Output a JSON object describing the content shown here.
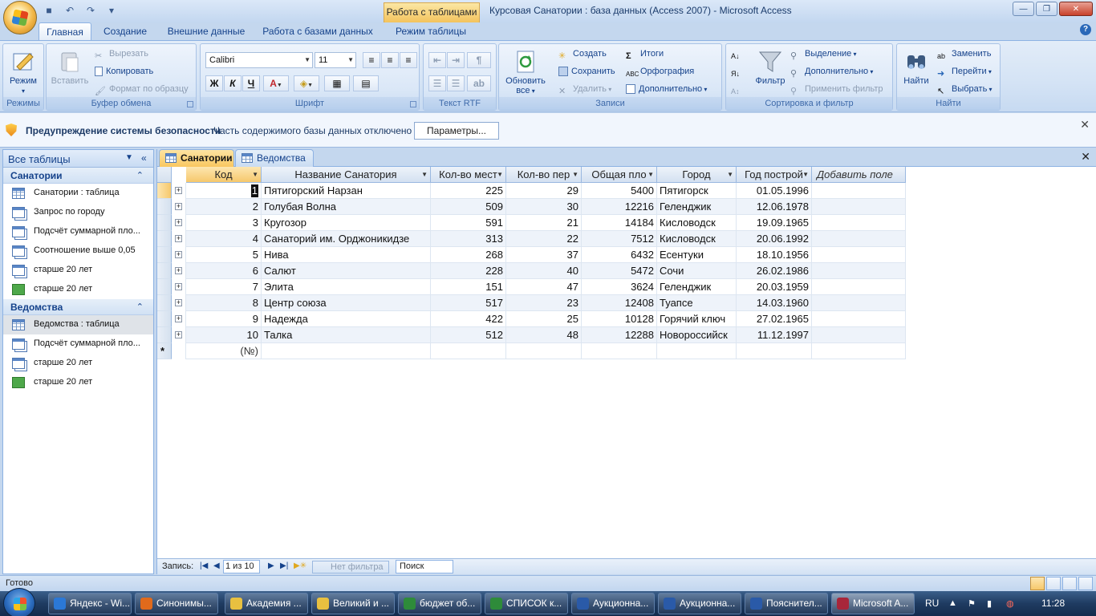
{
  "app": {
    "context_tab": "Работа с таблицами",
    "window_title": "Курсовая Санатории : база данных (Access 2007) - Microsoft Access"
  },
  "ribbon_tabs": [
    "Главная",
    "Создание",
    "Внешние данные",
    "Работа с базами данных",
    "Режим таблицы"
  ],
  "ribbon": {
    "modes": {
      "view_label": "Режим",
      "group_label": "Режимы"
    },
    "clipboard": {
      "paste": "Вставить",
      "cut": "Вырезать",
      "copy": "Копировать",
      "format_painter": "Формат по образцу",
      "group_label": "Буфер обмена"
    },
    "font": {
      "font_name": "Calibri",
      "font_size": "11",
      "bold": "Ж",
      "italic": "К",
      "underline": "Ч",
      "font_color_letter": "A",
      "group_label": "Шрифт"
    },
    "rtf": {
      "group_label": "Текст RTF"
    },
    "records": {
      "refresh": "Обновить",
      "refresh_all": "все",
      "create": "Создать",
      "save": "Сохранить",
      "delete": "Удалить",
      "totals": "Итоги",
      "spelling": "Орфография",
      "more": "Дополнительно",
      "group_label": "Записи"
    },
    "sort_filter": {
      "filter": "Фильтр",
      "selection": "Выделение",
      "advanced": "Дополнительно",
      "toggle_filter": "Применить фильтр",
      "group_label": "Сортировка и фильтр"
    },
    "find": {
      "find": "Найти",
      "replace": "Заменить",
      "goto": "Перейти",
      "select": "Выбрать",
      "group_label": "Найти"
    }
  },
  "security": {
    "title": "Предупреждение системы безопасности",
    "message": "Часть содержимого базы данных отключено",
    "button": "Параметры..."
  },
  "nav": {
    "header": "Все таблицы",
    "groups": [
      {
        "title": "Санатории",
        "items": [
          {
            "label": "Санатории : таблица",
            "icon": "table-icon"
          },
          {
            "label": "Запрос по городу",
            "icon": "query-icon"
          },
          {
            "label": "Подсчёт суммарной пло...",
            "icon": "query-icon"
          },
          {
            "label": "Соотношение выше 0,05",
            "icon": "query-icon"
          },
          {
            "label": "старше 20 лет",
            "icon": "query-icon"
          },
          {
            "label": "старше 20 лет",
            "icon": "form-icon"
          }
        ]
      },
      {
        "title": "Ведомства",
        "items": [
          {
            "label": "Ведомства : таблица",
            "icon": "table-icon"
          },
          {
            "label": "Подсчёт суммарной пло...",
            "icon": "query-icon"
          },
          {
            "label": "старше 20 лет",
            "icon": "query-icon"
          },
          {
            "label": "старше 20 лет",
            "icon": "form-icon"
          }
        ]
      }
    ]
  },
  "doc_tabs": [
    "Санатории",
    "Ведомства"
  ],
  "table": {
    "columns": [
      "Код",
      "Название Санатория",
      "Кол-во мест",
      "Кол-во пер",
      "Общая пло",
      "Город",
      "Год построй",
      "Добавить поле"
    ],
    "rows": [
      [
        "1",
        "Пятигорский Нарзан",
        "225",
        "29",
        "5400",
        "Пятигорск",
        "01.05.1996"
      ],
      [
        "2",
        "Голубая Волна",
        "509",
        "30",
        "12216",
        "Геленджик",
        "12.06.1978"
      ],
      [
        "3",
        "Кругозор",
        "591",
        "21",
        "14184",
        "Кисловодск",
        "19.09.1965"
      ],
      [
        "4",
        "Санаторий им. Орджоникидзе",
        "313",
        "22",
        "7512",
        "Кисловодск",
        "20.06.1992"
      ],
      [
        "5",
        "Нива",
        "268",
        "37",
        "6432",
        "Есентуки",
        "18.10.1956"
      ],
      [
        "6",
        "Салют",
        "228",
        "40",
        "5472",
        "Сочи",
        "26.02.1986"
      ],
      [
        "7",
        "Элита",
        "151",
        "47",
        "3624",
        "Геленджик",
        "20.03.1959"
      ],
      [
        "8",
        "Центр союза",
        "517",
        "23",
        "12408",
        "Туапсе",
        "14.03.1960"
      ],
      [
        "9",
        "Надежда",
        "422",
        "25",
        "10128",
        "Горячий ключ",
        "27.02.1965"
      ],
      [
        "10",
        "Талка",
        "512",
        "48",
        "12288",
        "Новороссийск",
        "11.12.1997"
      ]
    ],
    "new_row_placeholder": "(№)",
    "new_row_marker": "*"
  },
  "record_nav": {
    "label": "Запись:",
    "position": "1 из 10",
    "filter": "Нет фильтра",
    "search": "Поиск"
  },
  "status": "Готово",
  "taskbar": {
    "items": [
      {
        "label": "Яндекс - Wi...",
        "color": "#2b78d6"
      },
      {
        "label": "Синонимы...",
        "color": "#e06a1c"
      },
      {
        "label": "Академия ...",
        "color": "#e8c040"
      },
      {
        "label": "Великий и ...",
        "color": "#e8c040"
      },
      {
        "label": "бюджет об...",
        "color": "#2e8b3a"
      },
      {
        "label": "СПИСОК к...",
        "color": "#2e8b3a"
      },
      {
        "label": "Аукционна...",
        "color": "#2a5aa8"
      },
      {
        "label": "Аукционна...",
        "color": "#2a5aa8"
      },
      {
        "label": "Пояснител...",
        "color": "#2a5aa8"
      },
      {
        "label": "Microsoft A...",
        "color": "#a8263a"
      }
    ],
    "language": "RU",
    "clock": "11:28"
  }
}
